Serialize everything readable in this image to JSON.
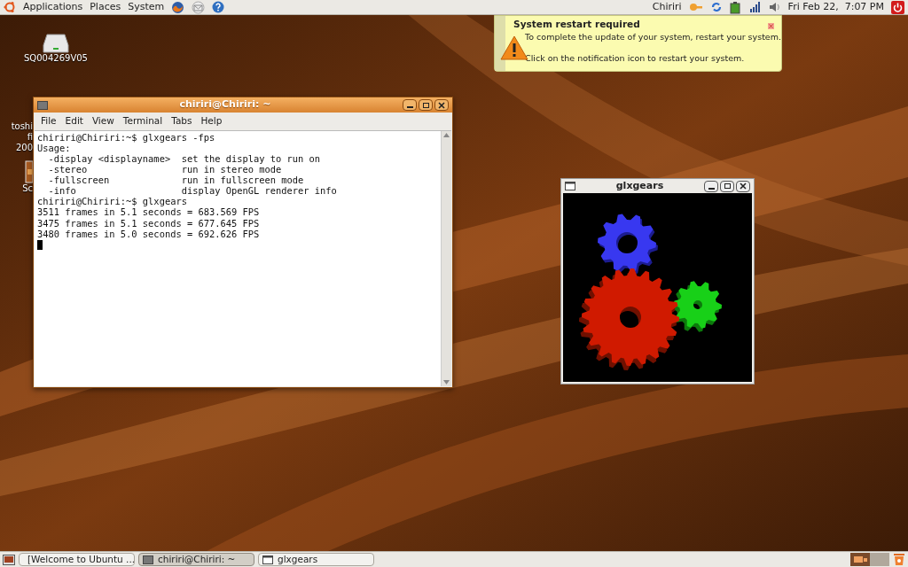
{
  "top_panel": {
    "menus": [
      "Applications",
      "Places",
      "System"
    ],
    "user": "Chiriri",
    "clock": "Fri Feb 22,  7:07 PM"
  },
  "desktop_icons": [
    {
      "kind": "drive",
      "lines": [
        "SQ004269V05"
      ]
    },
    {
      "kind": "folder",
      "lines": [
        "toshi",
        "fi",
        "200"
      ]
    },
    {
      "kind": "file",
      "lines": [
        "Sc"
      ]
    }
  ],
  "notification": {
    "title": "System restart required",
    "lines": [
      "To complete the update of your system, restart your system.",
      "Click on the notification icon to restart your system."
    ]
  },
  "terminal": {
    "title": "chiriri@Chiriri: ~",
    "menus": [
      "File",
      "Edit",
      "View",
      "Terminal",
      "Tabs",
      "Help"
    ],
    "lines": [
      "chiriri@Chiriri:~$ glxgears -fps",
      "Usage:",
      "  -display <displayname>  set the display to run on",
      "  -stereo                 run in stereo mode",
      "  -fullscreen             run in fullscreen mode",
      "  -info                   display OpenGL renderer info",
      "chiriri@Chiriri:~$ glxgears",
      "3511 frames in 5.1 seconds = 683.569 FPS",
      "3475 frames in 5.1 seconds = 677.645 FPS",
      "3480 frames in 5.0 seconds = 692.626 FPS"
    ]
  },
  "gears_window": {
    "title": "glxgears"
  },
  "taskbar": {
    "items": [
      {
        "kind": "browser",
        "label": "[Welcome to Ubuntu ...",
        "selected": false
      },
      {
        "kind": "terminal",
        "label": "chiriri@Chiriri: ~",
        "selected": true
      },
      {
        "kind": "window",
        "label": "glxgears",
        "selected": false
      }
    ],
    "workspaces": [
      {
        "selected": true
      },
      {
        "selected": false
      }
    ]
  }
}
